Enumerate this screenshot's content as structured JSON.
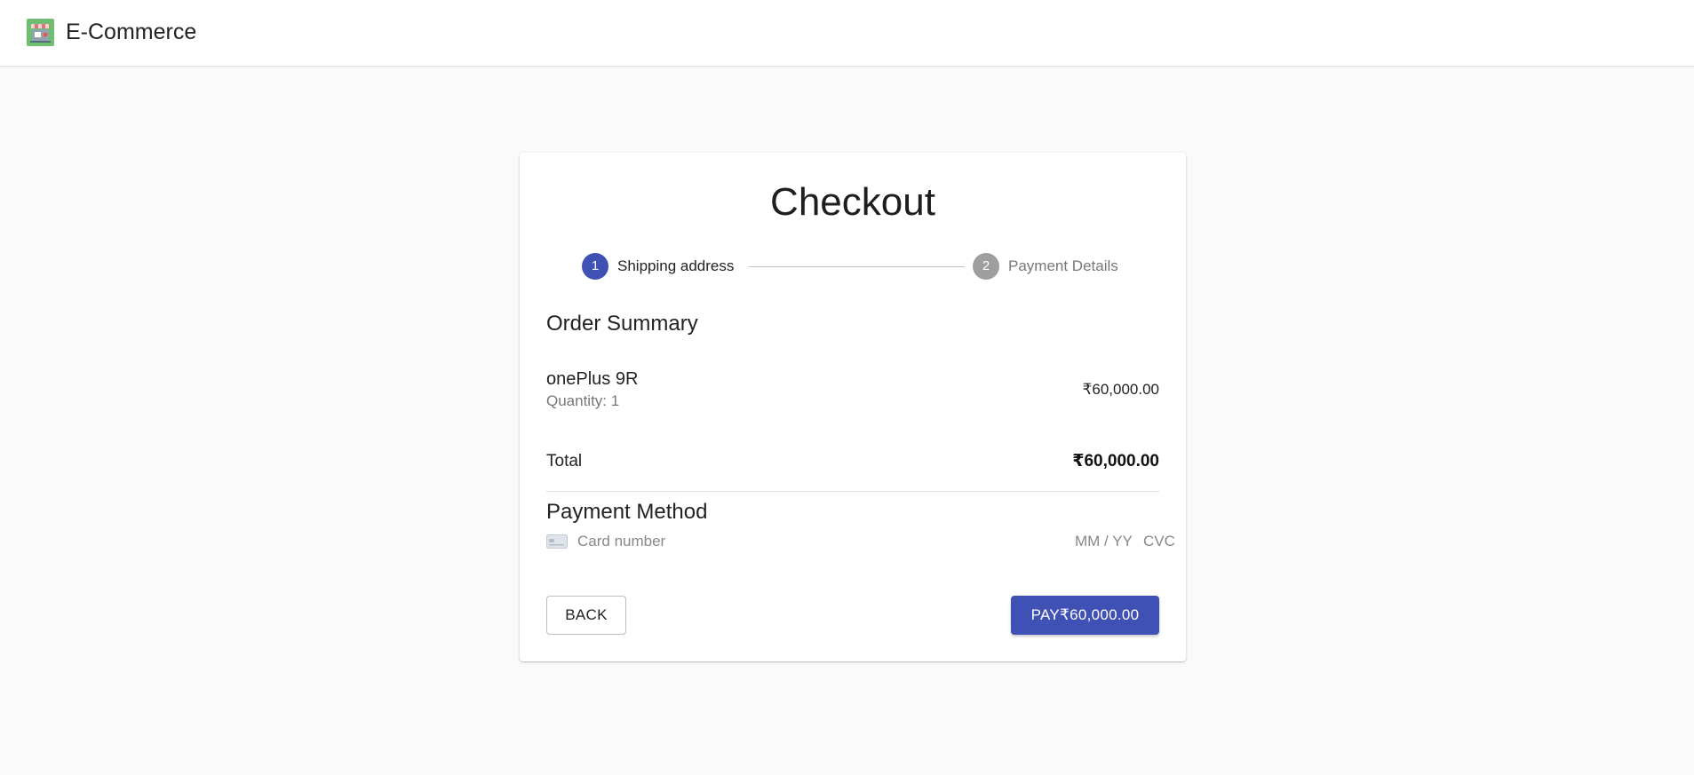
{
  "app": {
    "brand": "E-Commerce"
  },
  "checkout": {
    "title": "Checkout",
    "steps": [
      {
        "number": "1",
        "label": "Shipping address",
        "active": true
      },
      {
        "number": "2",
        "label": "Payment Details",
        "active": false
      }
    ],
    "order_summary": {
      "heading": "Order Summary",
      "items": [
        {
          "name": "onePlus 9R",
          "quantity_label": "Quantity: 1",
          "price": "₹60,000.00"
        }
      ],
      "total_label": "Total",
      "total_value": "₹60,000.00"
    },
    "payment": {
      "heading": "Payment Method",
      "card_number_placeholder": "Card number",
      "expiry_placeholder": "MM / YY",
      "cvc_placeholder": "CVC"
    },
    "actions": {
      "back_label": "BACK",
      "pay_label": "PAY₹60,000.00"
    }
  },
  "colors": {
    "primary": "#3f51b5",
    "inactive_step": "#9e9e9e",
    "background": "#fafafa"
  },
  "icons": {
    "logo": "store-logo-icon",
    "card": "credit-card-icon"
  }
}
